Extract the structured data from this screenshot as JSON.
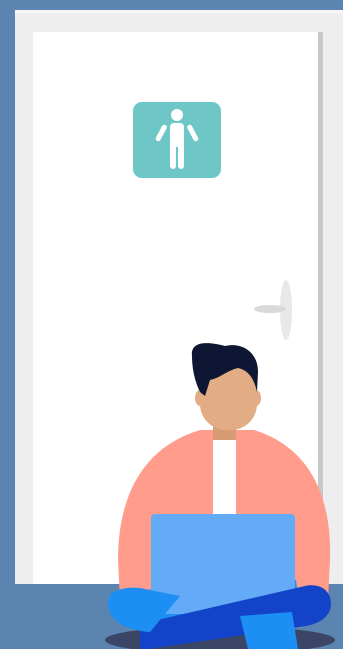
{
  "illustration": {
    "background_color": "#5b84b1",
    "floor_color": "#5b84b1",
    "door_frame_color": "#eeeeee",
    "door_color": "#ffffff",
    "door_edge_shadow_color": "#c8c8c8",
    "sign": {
      "icon": "male-restroom-icon",
      "background_color": "#6fc6c6",
      "figure_color": "#ffffff"
    },
    "handle_color": "#e8e8e8",
    "person": {
      "hair_color": "#0f1634",
      "skin_color": "#e2ad84",
      "jacket_color": "#ff9c8c",
      "shirt_color": "#ffffff",
      "laptop_color": "#63aaf7",
      "pants_color": "#1d8ef3",
      "pants_dark_color": "#1343c9",
      "shadow_color": "#3b4667"
    }
  }
}
